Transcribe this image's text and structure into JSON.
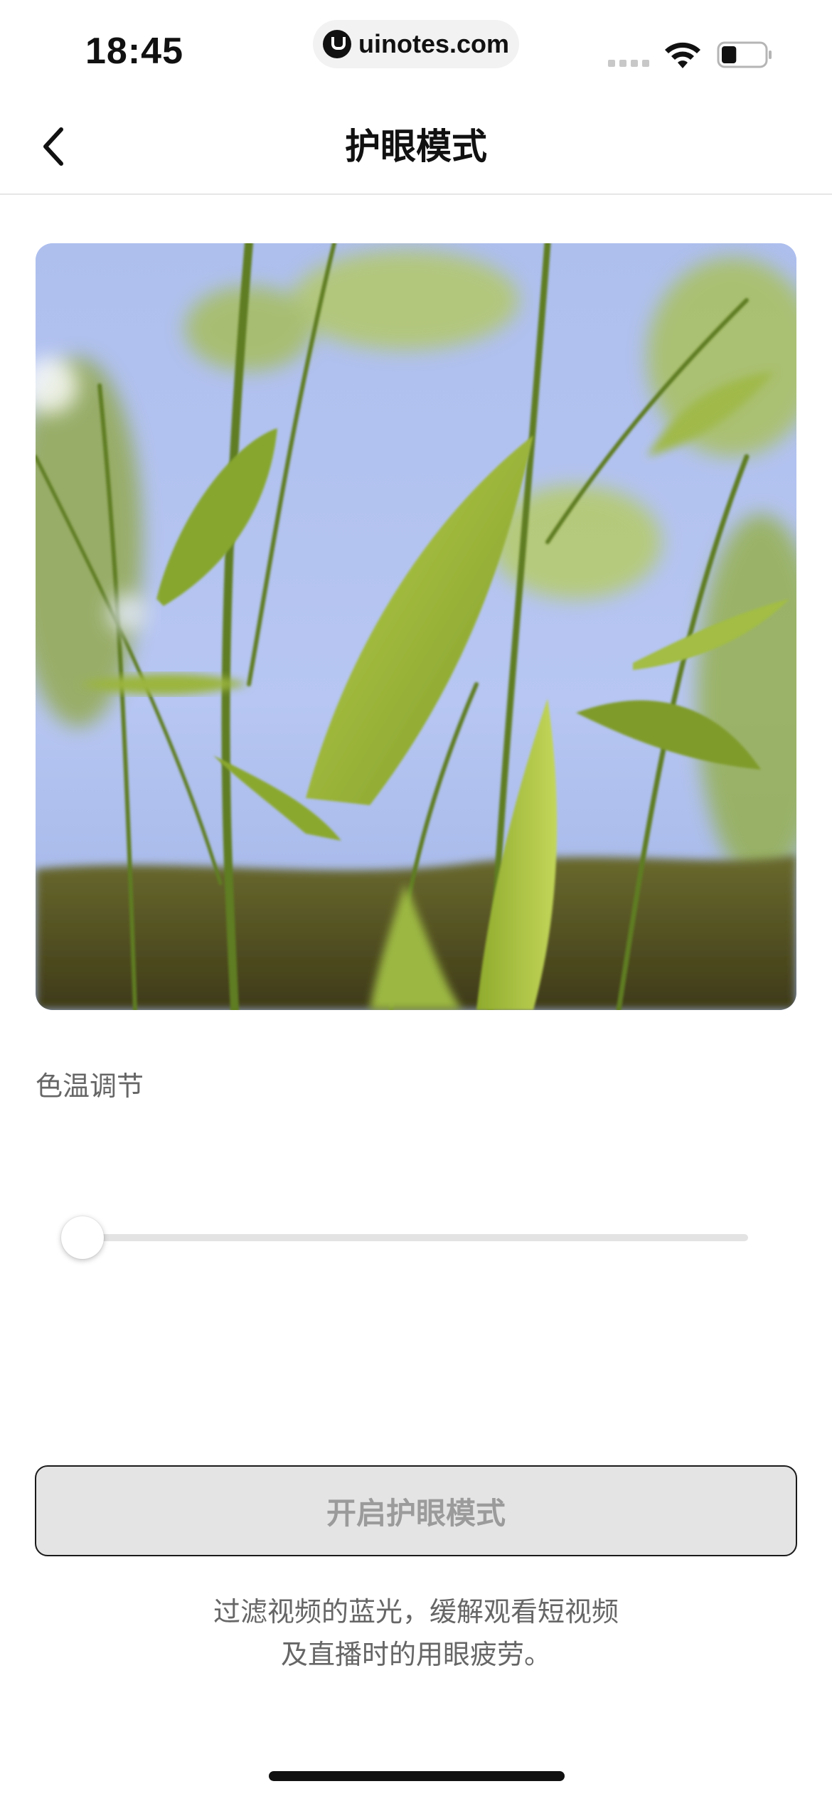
{
  "status_bar": {
    "time": "18:45",
    "url": "uinotes.com",
    "wifi_icon": "wifi-icon",
    "battery_icon": "battery-icon",
    "battery_level": 0.35
  },
  "nav": {
    "back_icon": "chevron-left-icon",
    "title": "护眼模式"
  },
  "preview": {
    "image_description_icon": "bamboo-leaves-image"
  },
  "color_temperature": {
    "label": "色温调节",
    "value": 0.0
  },
  "enable_button": {
    "label": "开启护眼模式",
    "enabled": false
  },
  "description": {
    "lines": [
      "过滤视频的蓝光，缓解观看短视频",
      "及直播时的用眼疲劳。"
    ]
  },
  "colors": {
    "button_bg": "#e4e4e4",
    "button_text": "#9b9b9b",
    "label_text": "#666666",
    "slider_track": "#e3e3e3"
  }
}
